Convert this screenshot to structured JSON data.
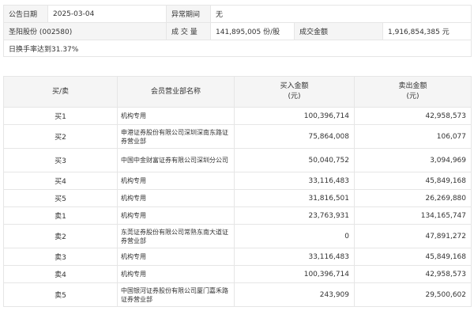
{
  "info": {
    "date_label": "公告日期",
    "date_value": "2025-03-04",
    "abnormal_label": "异常期间",
    "abnormal_value": "无",
    "stock": "圣阳股份 (002580)",
    "volume_label": "成 交 量",
    "volume_value": "141,895,005 份/股",
    "amount_label": "成交金额",
    "amount_value": "1,916,854,385 元",
    "reason": "日换手率达到31.37%"
  },
  "table": {
    "headers": {
      "direction": "买/卖",
      "member": "会员营业部名称",
      "buy": "买入金额\n(元)",
      "sell": "卖出金额\n(元)"
    },
    "rows": [
      {
        "dir": "买1",
        "name": "机构专用",
        "buy": "100,396,714",
        "sell": "42,958,573"
      },
      {
        "dir": "买2",
        "name": "申港证券股份有限公司深圳深南东路证券营业部",
        "buy": "75,864,008",
        "sell": "106,077"
      },
      {
        "dir": "买3",
        "name": "中国中金财富证券有限公司深圳分公司",
        "buy": "50,040,752",
        "sell": "3,094,969"
      },
      {
        "dir": "买4",
        "name": "机构专用",
        "buy": "33,116,483",
        "sell": "45,849,168"
      },
      {
        "dir": "买5",
        "name": "机构专用",
        "buy": "31,816,501",
        "sell": "26,269,880"
      },
      {
        "dir": "卖1",
        "name": "机构专用",
        "buy": "23,763,931",
        "sell": "134,165,747"
      },
      {
        "dir": "卖2",
        "name": "东莞证券股份有限公司常熟东南大道证券营业部",
        "buy": "0",
        "sell": "47,891,272"
      },
      {
        "dir": "卖3",
        "name": "机构专用",
        "buy": "33,116,483",
        "sell": "45,849,168"
      },
      {
        "dir": "卖4",
        "name": "机构专用",
        "buy": "100,396,714",
        "sell": "42,958,573"
      },
      {
        "dir": "卖5",
        "name": "中国银河证券股份有限公司厦门嘉禾路证券营业部",
        "buy": "243,909",
        "sell": "29,500,602"
      }
    ]
  }
}
